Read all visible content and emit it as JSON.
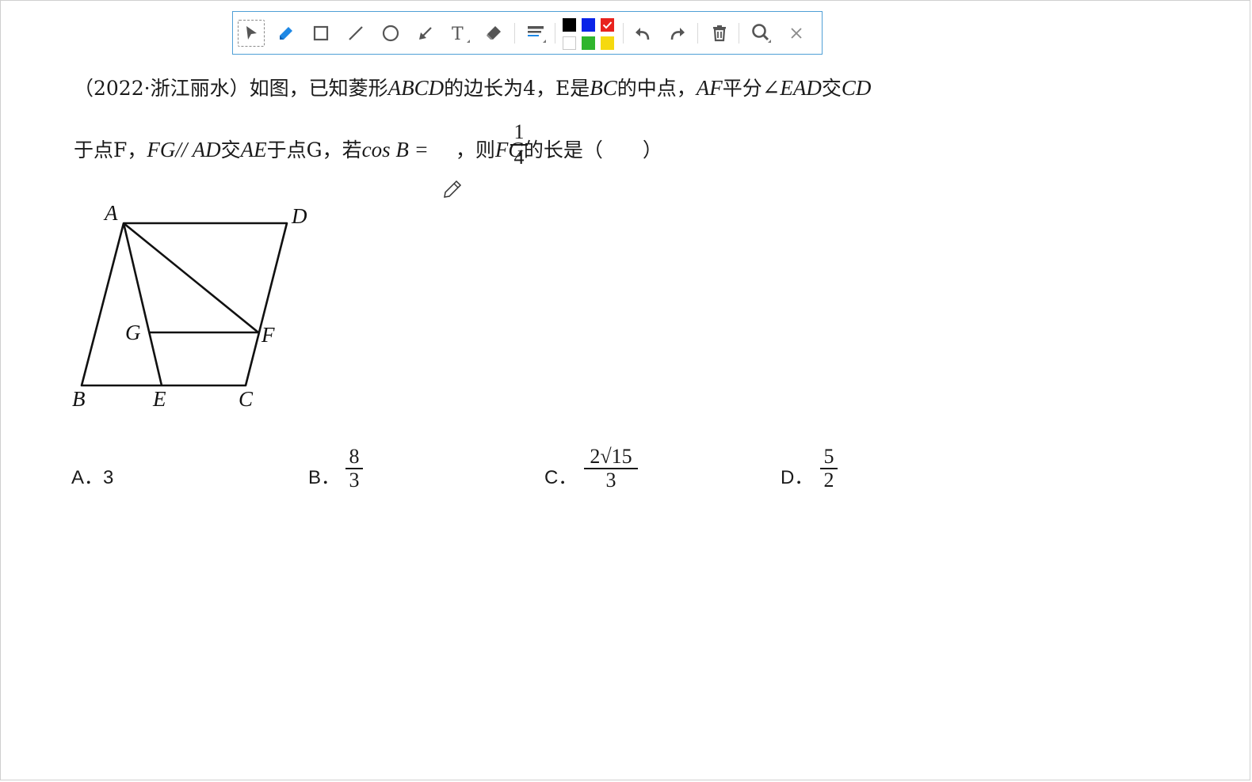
{
  "toolbar": {
    "tools": [
      {
        "name": "select",
        "icon": "arrow-cursor-icon"
      },
      {
        "name": "pen",
        "icon": "pen-icon"
      },
      {
        "name": "rectangle",
        "icon": "rectangle-icon"
      },
      {
        "name": "line",
        "icon": "line-icon"
      },
      {
        "name": "circle",
        "icon": "circle-icon"
      },
      {
        "name": "arrow",
        "icon": "arrow-icon"
      },
      {
        "name": "text",
        "icon": "text-icon",
        "label": "T"
      },
      {
        "name": "eraser",
        "icon": "eraser-icon"
      },
      {
        "name": "line-width",
        "icon": "line-width-icon"
      },
      {
        "name": "undo",
        "icon": "undo-icon"
      },
      {
        "name": "redo",
        "icon": "redo-icon"
      },
      {
        "name": "delete",
        "icon": "trash-icon"
      },
      {
        "name": "zoom",
        "icon": "search-icon"
      },
      {
        "name": "close",
        "icon": "close-icon"
      }
    ],
    "colors": [
      "#000000",
      "#0a24e8",
      "#e8231e",
      "#ffffff",
      "#2fb52d",
      "#f5d90f"
    ],
    "selected_color": "#e8231e",
    "accent": "#4f9fd6"
  },
  "question": {
    "line1": {
      "source": "（2022·浙江丽水）",
      "t1": "如图，已知菱形",
      "m1": "ABCD",
      "t2": "的边长为4，E是",
      "m2": "BC",
      "t3": "的中点，",
      "m3": "AF",
      "t4": "平分",
      "m4": "∠EAD",
      "t5": "交",
      "m5": "CD"
    },
    "line2": {
      "t1": "于点F，",
      "m1": "FG// AD",
      "t2": "交",
      "m2": "AE",
      "t3": "于点G，若",
      "m3": "cos B =",
      "frac_num": "1",
      "frac_den": "4",
      "t4": "，则",
      "m4": "FG",
      "t5": "的长是（　　）"
    }
  },
  "figure": {
    "points": {
      "A": "A",
      "B": "B",
      "C": "C",
      "D": "D",
      "E": "E",
      "F": "F",
      "G": "G"
    }
  },
  "options": [
    {
      "letter": "A．",
      "value": "3"
    },
    {
      "letter": "B．",
      "num": "8",
      "den": "3"
    },
    {
      "letter": "C．",
      "num": "2√15",
      "den": "3"
    },
    {
      "letter": "D．",
      "num": "5",
      "den": "2"
    }
  ]
}
